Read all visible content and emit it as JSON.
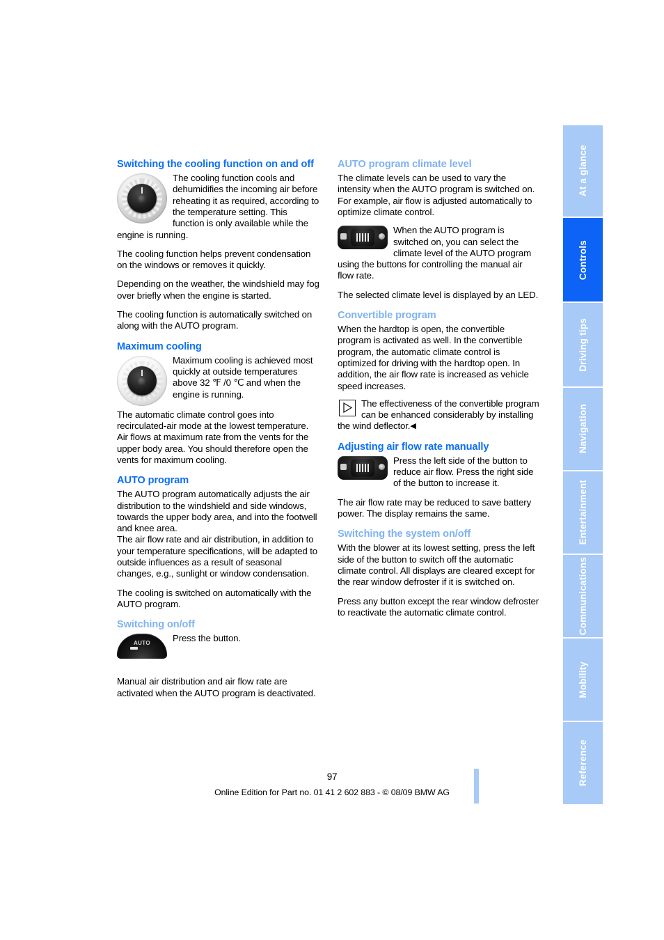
{
  "page": {
    "number": "97",
    "footer": "Online Edition for Part no. 01 41 2 602 883 - © 08/09 BMW AG"
  },
  "colors": {
    "heading_major": "#0c6ff5",
    "heading_minor": "#7fb3f2",
    "tab_inactive": "#a7caf7",
    "tab_active": "#0c63f6"
  },
  "tabs": [
    {
      "label": "At a glance",
      "active": false
    },
    {
      "label": "Controls",
      "active": true
    },
    {
      "label": "Driving tips",
      "active": false
    },
    {
      "label": "Navigation",
      "active": false
    },
    {
      "label": "Entertainment",
      "active": false
    },
    {
      "label": "Communications",
      "active": false
    },
    {
      "label": "Mobility",
      "active": false
    },
    {
      "label": "Reference",
      "active": false
    }
  ],
  "left_column": {
    "s1": {
      "heading": "Switching the cooling function on and off",
      "icon": "rotary-knob-icon",
      "fig_text": "The cooling function cools and dehumidifies the incoming air before reheating it as required, according to the temperature setting. This function is only available while the engine is running.",
      "p2": "The cooling function helps prevent condensation on the windows or removes it quickly.",
      "p3": "Depending on the weather, the windshield may fog over briefly when the engine is started.",
      "p4": "The cooling function is automatically switched on along with the AUTO program."
    },
    "s2": {
      "heading": "Maximum cooling",
      "icon": "rotary-knob-icon",
      "fig_text": "Maximum cooling is achieved most quickly at outside temperatures above 32 ℉ /0 ℃ and when the engine is running.",
      "p2": "The automatic climate control goes into recirculated-air mode at the lowest temperature. Air flows at maximum rate from the vents for the upper body area. You should therefore open the vents for maximum cooling."
    },
    "s3": {
      "heading": "AUTO program",
      "p1": "The AUTO program automatically adjusts the air distribution to the windshield and side windows, towards the upper body area, and into the footwell and knee area.",
      "p2": "The air flow rate and air distribution, in addition to your temperature specifications, will be adapted to outside influences as a result of seasonal changes, e.g., sunlight or window condensation.",
      "p3": "The cooling is switched on automatically with the AUTO program."
    },
    "s4": {
      "heading": "Switching on/off",
      "icon": "auto-button-icon",
      "fig_text": "Press the button.",
      "p2": "Manual air distribution and air flow rate are activated when the AUTO program is deactivated."
    }
  },
  "right_column": {
    "s1": {
      "heading": "AUTO program climate level",
      "p1": "The climate levels can be used to vary the intensity when the AUTO program is switched on. For example, air flow is adjusted automatically to optimize climate control.",
      "icon": "fan-rocker-button-icon",
      "fig_text": "When the AUTO program is switched on, you can select the climate level of the AUTO program using the buttons for controlling the manual air flow rate.",
      "p3": "The selected climate level is displayed by an LED."
    },
    "s2": {
      "heading": "Convertible program",
      "p1": "When the hardtop is open, the convertible program is activated as well. In the convertible program, the automatic climate control is optimized for driving with the hardtop open. In addition, the air flow rate is increased as vehicle speed increases.",
      "note_icon": "note-play-triangle-icon",
      "note_text": "The effectiveness of the convertible program can be enhanced considerably by installing the wind deflector.",
      "note_endmark": "◀"
    },
    "s3": {
      "heading": "Adjusting air flow rate manually",
      "icon": "fan-rocker-button-icon",
      "fig_text": "Press the left side of the button to reduce air flow. Press the right side of the button to increase it.",
      "p2": "The air flow rate may be reduced to save battery power. The display remains the same."
    },
    "s4": {
      "heading": "Switching the system on/off",
      "p1": "With the blower at its lowest setting, press the left side of the button to switch off the automatic climate control. All displays are cleared except for the rear window defroster if it is switched on.",
      "p2": "Press any button except the rear window defroster to reactivate the automatic climate control."
    }
  }
}
